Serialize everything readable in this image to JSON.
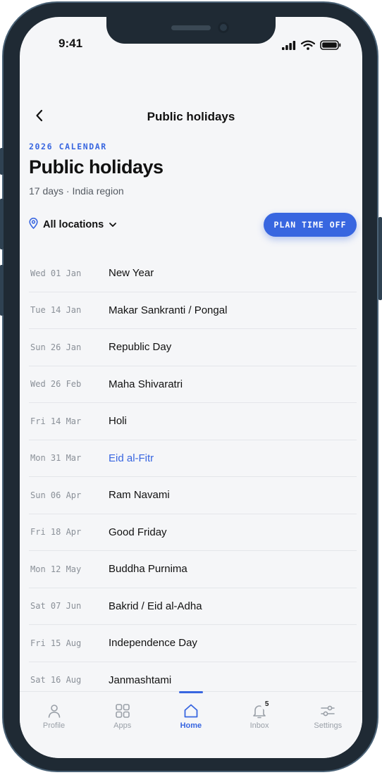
{
  "status": {
    "time": "9:41"
  },
  "nav": {
    "title": "Public holidays"
  },
  "header": {
    "eyebrow": "2026 CALENDAR",
    "title": "Public holidays",
    "subtitle": "17 days · India region"
  },
  "filter": {
    "location_label": "All locations"
  },
  "actions": {
    "plan_label": "PLAN TIME OFF"
  },
  "holidays": [
    {
      "date": "Wed 01 Jan",
      "name": "New Year",
      "highlight": false
    },
    {
      "date": "Tue 14 Jan",
      "name": "Makar Sankranti / Pongal",
      "highlight": false
    },
    {
      "date": "Sun 26 Jan",
      "name": "Republic Day",
      "highlight": false
    },
    {
      "date": "Wed 26 Feb",
      "name": "Maha Shivaratri",
      "highlight": false
    },
    {
      "date": "Fri 14 Mar",
      "name": "Holi",
      "highlight": false
    },
    {
      "date": "Mon 31 Mar",
      "name": "Eid al-Fitr",
      "highlight": true
    },
    {
      "date": "Sun 06 Apr",
      "name": "Ram Navami",
      "highlight": false
    },
    {
      "date": "Fri 18 Apr",
      "name": "Good Friday",
      "highlight": false
    },
    {
      "date": "Mon 12 May",
      "name": "Buddha Purnima",
      "highlight": false
    },
    {
      "date": "Sat 07 Jun",
      "name": "Bakrid / Eid al-Adha",
      "highlight": false
    },
    {
      "date": "Fri 15 Aug",
      "name": "Independence Day",
      "highlight": false
    },
    {
      "date": "Sat 16 Aug",
      "name": "Janmashtami",
      "highlight": false
    }
  ],
  "tabbar": {
    "tabs": [
      {
        "label": "Profile",
        "icon": "person-icon",
        "active": false
      },
      {
        "label": "Apps",
        "icon": "grid-icon",
        "active": false
      },
      {
        "label": "Home",
        "icon": "home-icon",
        "active": true
      },
      {
        "label": "Inbox",
        "icon": "bell-icon",
        "active": false,
        "badge": "5"
      },
      {
        "label": "Settings",
        "icon": "sliders-icon",
        "active": false
      }
    ]
  },
  "colors": {
    "accent": "#3866e0",
    "text": "#111111",
    "muted": "#8a9098",
    "background": "#f5f6f8"
  }
}
